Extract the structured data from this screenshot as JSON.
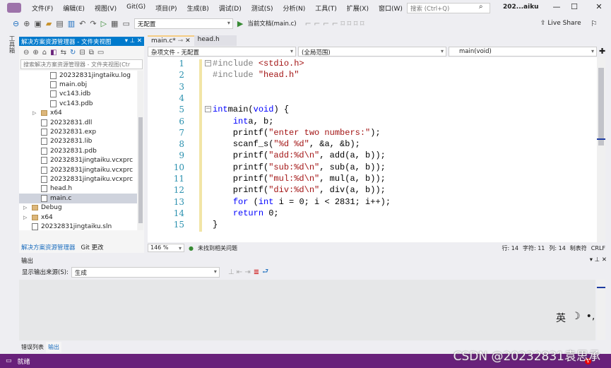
{
  "menu": {
    "items": [
      "文件(F)",
      "编辑(E)",
      "视图(V)",
      "Git(G)",
      "项目(P)",
      "生成(B)",
      "调试(D)",
      "测试(S)",
      "分析(N)",
      "工具(T)",
      "扩展(X)",
      "窗口(W)",
      "帮助(H)"
    ],
    "search_placeholder": "搜索 (Ctrl+Q)",
    "window_title": "202...aiku"
  },
  "toolbar": {
    "config": "无配置",
    "run": "当前文档(main.c)",
    "live_share": "Live Share"
  },
  "toolbox_label": "工具箱",
  "solution_explorer": {
    "title": "解决方案资源管理器 - 文件夹视图",
    "search_placeholder": "搜索解决方案资源管理器 - 文件夹视图(Ctr",
    "items": [
      {
        "label": "20232831jingtaiku.log",
        "indent": 3,
        "icon": "file"
      },
      {
        "label": "main.obj",
        "indent": 3,
        "icon": "obj"
      },
      {
        "label": "vc143.idb",
        "indent": 3,
        "icon": "idb"
      },
      {
        "label": "vc143.pdb",
        "indent": 3,
        "icon": "pdb"
      },
      {
        "label": "x64",
        "indent": 2,
        "icon": "folder",
        "expander": true
      },
      {
        "label": "20232831.dll",
        "indent": 2,
        "icon": "dll"
      },
      {
        "label": "20232831.exp",
        "indent": 2,
        "icon": "exp"
      },
      {
        "label": "20232831.lib",
        "indent": 2,
        "icon": "lib"
      },
      {
        "label": "20232831.pdb",
        "indent": 2,
        "icon": "pdb"
      },
      {
        "label": "20232831jingtaiku.vcxprc",
        "indent": 2,
        "icon": "vcxproj"
      },
      {
        "label": "20232831jingtaiku.vcxprc",
        "indent": 2,
        "icon": "file"
      },
      {
        "label": "20232831jingtaiku.vcxprc",
        "indent": 2,
        "icon": "vcxproj"
      },
      {
        "label": "head.h",
        "indent": 2,
        "icon": "header"
      },
      {
        "label": "main.c",
        "indent": 2,
        "icon": "c-file",
        "selected": true
      },
      {
        "label": "Debug",
        "indent": 1,
        "icon": "folder",
        "expander": true
      },
      {
        "label": "x64",
        "indent": 1,
        "icon": "folder",
        "expander": true
      },
      {
        "label": "20232831jingtaiku.sln",
        "indent": 1,
        "icon": "sln"
      }
    ],
    "tabs": [
      "解决方案资源管理器",
      "Git 更改"
    ]
  },
  "editor": {
    "tabs": [
      "main.c*",
      "head.h"
    ],
    "nav": [
      "杂项文件 - 无配置",
      "(全局范围)",
      "main(void)"
    ],
    "lines": [
      [
        [
          "pp",
          "#include "
        ],
        [
          "str",
          "<stdio.h>"
        ]
      ],
      [
        [
          "pp",
          "#include "
        ],
        [
          "str",
          "\"head.h\""
        ]
      ],
      [],
      [],
      [
        [
          "kw",
          "int"
        ],
        [
          "",
          "main("
        ],
        [
          "kw",
          "void"
        ],
        [
          "",
          ") {"
        ]
      ],
      [
        [
          "",
          "    "
        ],
        [
          "kw",
          "int"
        ],
        [
          "",
          "a, b;"
        ]
      ],
      [
        [
          "",
          "    printf("
        ],
        [
          "str",
          "\"enter two numbers:\""
        ],
        [
          "",
          ");"
        ]
      ],
      [
        [
          "",
          "    scanf_s("
        ],
        [
          "str",
          "\"%d %d\""
        ],
        [
          "",
          ", &a, &b);"
        ]
      ],
      [
        [
          "",
          "    printf("
        ],
        [
          "str",
          "\"add:%d\\n\""
        ],
        [
          "",
          ", add(a, b));"
        ]
      ],
      [
        [
          "",
          "    printf("
        ],
        [
          "str",
          "\"sub:%d\\n\""
        ],
        [
          "",
          ", sub(a, b));"
        ]
      ],
      [
        [
          "",
          "    printf("
        ],
        [
          "str",
          "\"mul:%d\\n\""
        ],
        [
          "",
          ", mul(a, b));"
        ]
      ],
      [
        [
          "",
          "    printf("
        ],
        [
          "str",
          "\"div:%d\\n\""
        ],
        [
          "",
          ", div(a, b));"
        ]
      ],
      [
        [
          "",
          "    "
        ],
        [
          "kw",
          "for"
        ],
        [
          "",
          " ("
        ],
        [
          "kw",
          "int"
        ],
        [
          "",
          "",
          " i = 0; i < 2831; i++);"
        ]
      ],
      [
        [
          "",
          "    "
        ],
        [
          "kw",
          "return"
        ],
        [
          "",
          " 0;"
        ]
      ],
      [
        [
          "",
          "}"
        ]
      ]
    ],
    "status": {
      "zoom": "146 %",
      "issues": "未找到相关问题",
      "row": "行: 14",
      "char": "字符: 11",
      "col": "列: 14",
      "tabs": "制表符",
      "eol": "CRLF"
    }
  },
  "output": {
    "title": "输出",
    "source_label": "显示输出来源(S):",
    "source": "生成",
    "tabs": [
      "错误列表",
      "输出"
    ]
  },
  "ime": {
    "lang": "英",
    "moon": "☽",
    "punct": "•,"
  },
  "statusbar": {
    "text": "就绪",
    "notifications": "1",
    "color": "#68217a"
  },
  "watermark": "CSDN @20232831袁思承"
}
